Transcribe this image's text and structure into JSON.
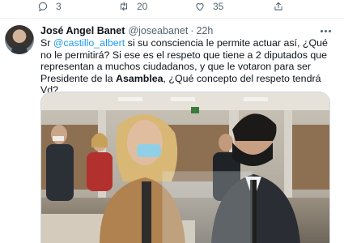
{
  "actions": {
    "reply_count": "3",
    "retweet_count": "20",
    "like_count": "35"
  },
  "tweet": {
    "author_name": "José Angel Banet",
    "author_handle": "@joseabanet",
    "separator": "·",
    "timestamp": "22h",
    "text_parts": {
      "p1": "Sr ",
      "mention": "@castillo_albert",
      "p2": " si su consciencia le permite actuar así, ¿Qué no le permitirá? Si ese es el respeto que tiene a 2 diputados que representan a muchos ciudadanos, y que le votaron para ser Presidente de la ",
      "bold": "Asamblea",
      "p3": ", ¿Qué concepto del respeto tendrá Vd?"
    },
    "media_description": "Photo in a parliament chamber"
  },
  "colors": {
    "link": "#1d9bf0",
    "secondary_text": "#536471",
    "separator": "#eff3f4"
  },
  "icons": [
    "reply-icon",
    "retweet-icon",
    "like-icon",
    "share-icon",
    "more-icon"
  ]
}
